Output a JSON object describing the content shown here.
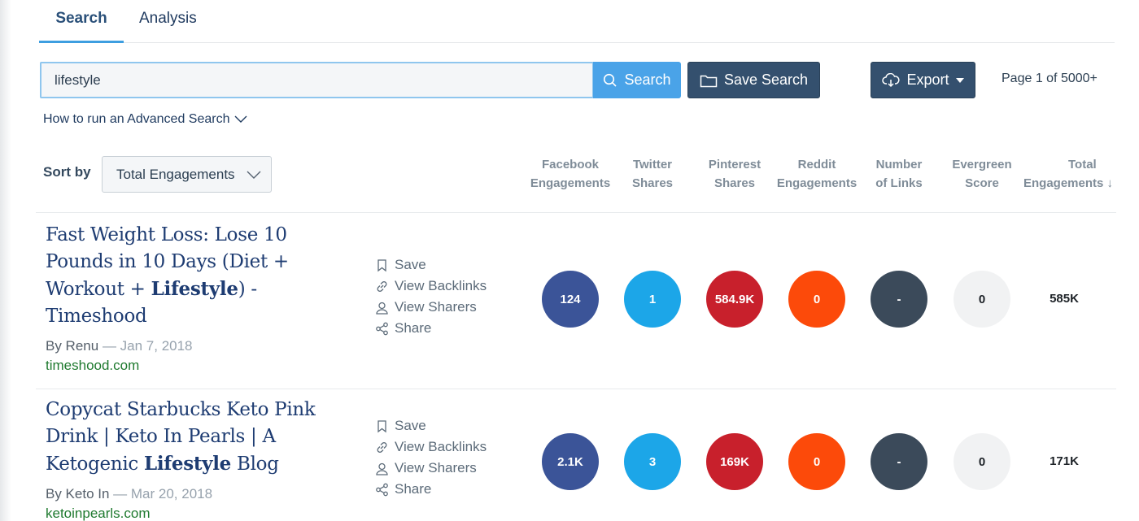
{
  "tabs": [
    {
      "label": "Search",
      "active": true
    },
    {
      "label": "Analysis",
      "active": false
    }
  ],
  "search": {
    "value": "lifestyle",
    "button_label": "Search"
  },
  "toolbar": {
    "save_search_label": "Save Search",
    "export_label": "Export",
    "pager_text": "Page 1 of 5000+"
  },
  "advanced_link": "How to run an Advanced Search",
  "sort": {
    "label": "Sort by",
    "selected": "Total Engagements"
  },
  "columns": [
    {
      "line1": "Facebook",
      "line2": "Engagements"
    },
    {
      "line1": "Twitter",
      "line2": "Shares"
    },
    {
      "line1": "Pinterest",
      "line2": "Shares"
    },
    {
      "line1": "Reddit",
      "line2": "Engagements"
    },
    {
      "line1": "Number",
      "line2": "of Links"
    },
    {
      "line1": "Evergreen",
      "line2": "Score"
    },
    {
      "line1": "Total",
      "line2": "Engagements ↓"
    }
  ],
  "actions": [
    "Save",
    "View Backlinks",
    "View Sharers",
    "Share"
  ],
  "colors": {
    "facebook": "#3b5498",
    "twitter": "#1ca6e8",
    "pinterest": "#c8202c",
    "reddit": "#fc4a0a",
    "links": "#3b4a5a",
    "evergreen": "#f1f2f3",
    "accent": "#4aa3e8",
    "dark_button": "#34506e",
    "domain_green": "#1f7a2f"
  },
  "results": [
    {
      "title_parts": [
        "Fast Weight Loss: Lose 10 Pounds in 10 Days (Diet + Workout + ",
        "Lifestyle",
        ") - Timeshood"
      ],
      "author": "By Renu",
      "date": "— Jan 7, 2018",
      "domain": "timeshood.com",
      "facebook": "124",
      "twitter": "1",
      "pinterest": "584.9K",
      "reddit": "0",
      "links": "-",
      "evergreen": "0",
      "total": "585K"
    },
    {
      "title_parts": [
        "Copycat Starbucks Keto Pink Drink | Keto In Pearls | A Ketogenic ",
        "Lifestyle",
        " Blog"
      ],
      "author": "By Keto In",
      "date": "— Mar 20, 2018",
      "domain": "ketoinpearls.com",
      "facebook": "2.1K",
      "twitter": "3",
      "pinterest": "169K",
      "reddit": "0",
      "links": "-",
      "evergreen": "0",
      "total": "171K"
    }
  ]
}
